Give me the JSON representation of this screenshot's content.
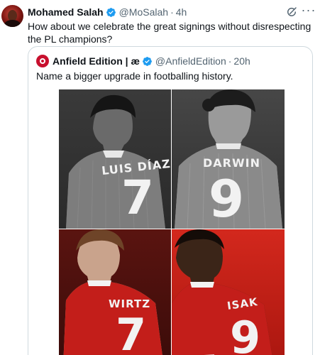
{
  "post": {
    "author_name": "Mohamed Salah",
    "author_handle": "@MoSalah",
    "separator": "·",
    "time": "4h",
    "more_label": "···",
    "text": "How about we celebrate the great signings without disrespecting the PL champions?"
  },
  "quote": {
    "author_name": "Anfield Edition | æ",
    "author_handle": "@AnfieldEdition",
    "separator": "·",
    "time": "20h",
    "text": "Name a bigger upgrade in footballing history."
  },
  "media": {
    "players": [
      {
        "name": "LUIS DÍAZ",
        "number": "7"
      },
      {
        "name": "DARWIN",
        "number": "9"
      },
      {
        "name": "WIRTZ",
        "number": "7"
      },
      {
        "name": "ISAK",
        "number": "9"
      }
    ]
  },
  "colors": {
    "verified": "#1d9bf0",
    "secondary_text": "#536471",
    "border": "#cfd9de",
    "liverpool_red": "#c8102e"
  },
  "icons": {
    "verified": "verified-badge-icon",
    "grok": "grok-icon",
    "more": "more-icon"
  }
}
